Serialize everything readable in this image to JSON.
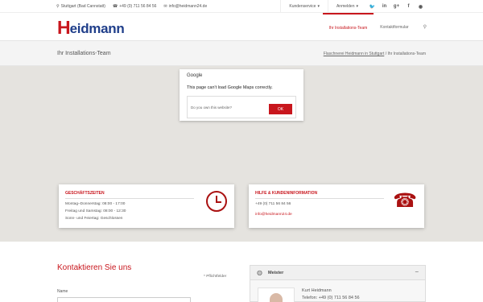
{
  "topbar": {
    "location": "Stuttgart (Bad Cannstatt)",
    "phone": "+49 (0) 711 56 84 56",
    "email": "info@heidmann24.de",
    "kundenservice": "Kundenservice",
    "anmelden": "Anmelden",
    "social": [
      "twitter-icon",
      "linkedin-icon",
      "google-plus-icon",
      "facebook-icon",
      "rss-icon"
    ]
  },
  "header": {
    "logo_h": "H",
    "logo_rest": "eidmann",
    "nav": [
      "Ihr Installations-Team",
      "Kontaktformular"
    ]
  },
  "titlebar": {
    "title": "Ihr Installations-Team",
    "crumb_link": "Flaschnerei Heidmann in Stuttgart",
    "crumb_sep": "/",
    "crumb_current": "Ihr Installations-Team"
  },
  "map_error": {
    "brand": "Google",
    "message": "This page can't load Google Maps correctly.",
    "question": "Do you own this website?",
    "ok": "OK"
  },
  "hours": {
    "title": "GESCHÄFTSZEITEN",
    "lines": [
      "Montag–Donnerstag: 08:00 - 17:00",
      "Freitag und Samstag: 08:00 - 12:30",
      "Sonn- und Feiertag: Geschlossen"
    ]
  },
  "info": {
    "title": "HILFE & KUNDENINFORMATION",
    "phone": "+49 (0) 711 56 84 56",
    "email": "info@heidmann24.de"
  },
  "contact": {
    "title": "Kontaktieren Sie uns",
    "required": "* Pflichtfelder",
    "name_label": "Name"
  },
  "meister": {
    "label": "Meister",
    "toggle": "−",
    "name": "Kurt Heidmann",
    "phone": "Telefon: +49 (0) 711 56 84 56"
  },
  "colors": {
    "accent": "#c8161d",
    "logo_blue": "#1f3e8a"
  }
}
